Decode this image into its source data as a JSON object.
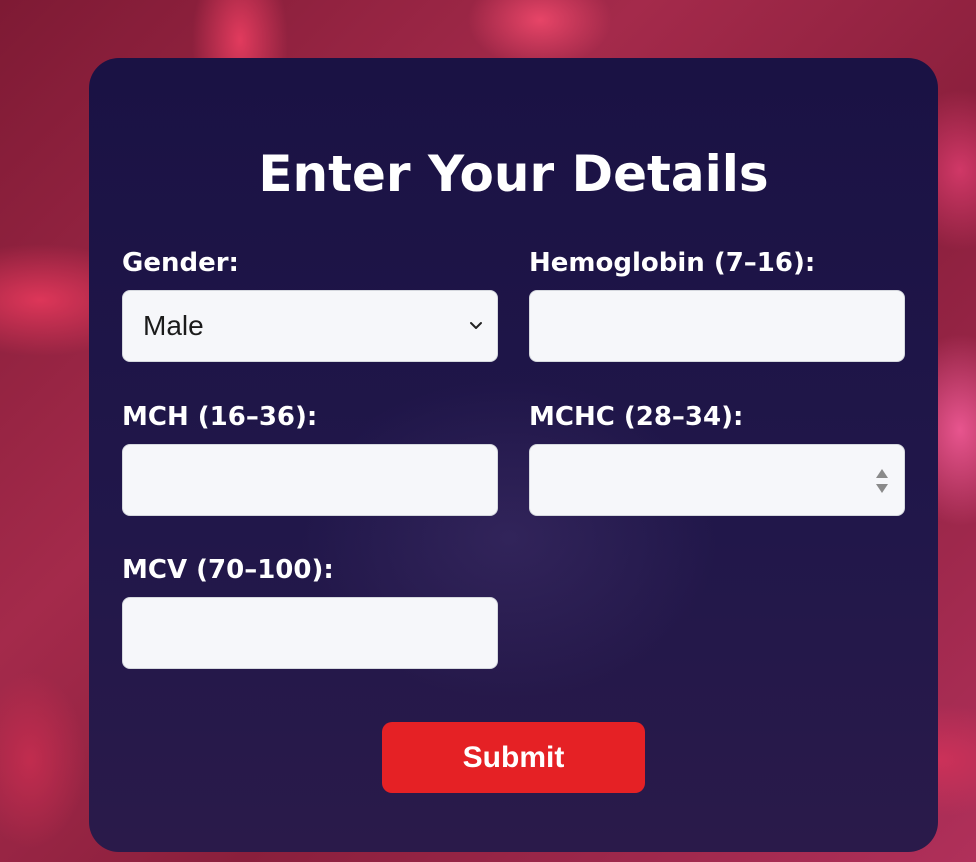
{
  "form": {
    "title": "Enter Your Details",
    "fields": {
      "gender": {
        "label": "Gender:",
        "value": "Male"
      },
      "hemoglobin": {
        "label": "Hemoglobin (7–16):",
        "value": ""
      },
      "mch": {
        "label": "MCH (16–36):",
        "value": ""
      },
      "mchc": {
        "label": "MCHC (28–34):",
        "value": ""
      },
      "mcv": {
        "label": "MCV (70–100):",
        "value": ""
      }
    },
    "submit_label": "Submit"
  },
  "colors": {
    "card_background": "#1a1244",
    "submit_button": "#e52125",
    "input_background": "#f6f7fa",
    "text": "#ffffff"
  },
  "icons": {
    "select_arrow": "chevron-down-icon",
    "number_spinner": "spinner-icon"
  }
}
